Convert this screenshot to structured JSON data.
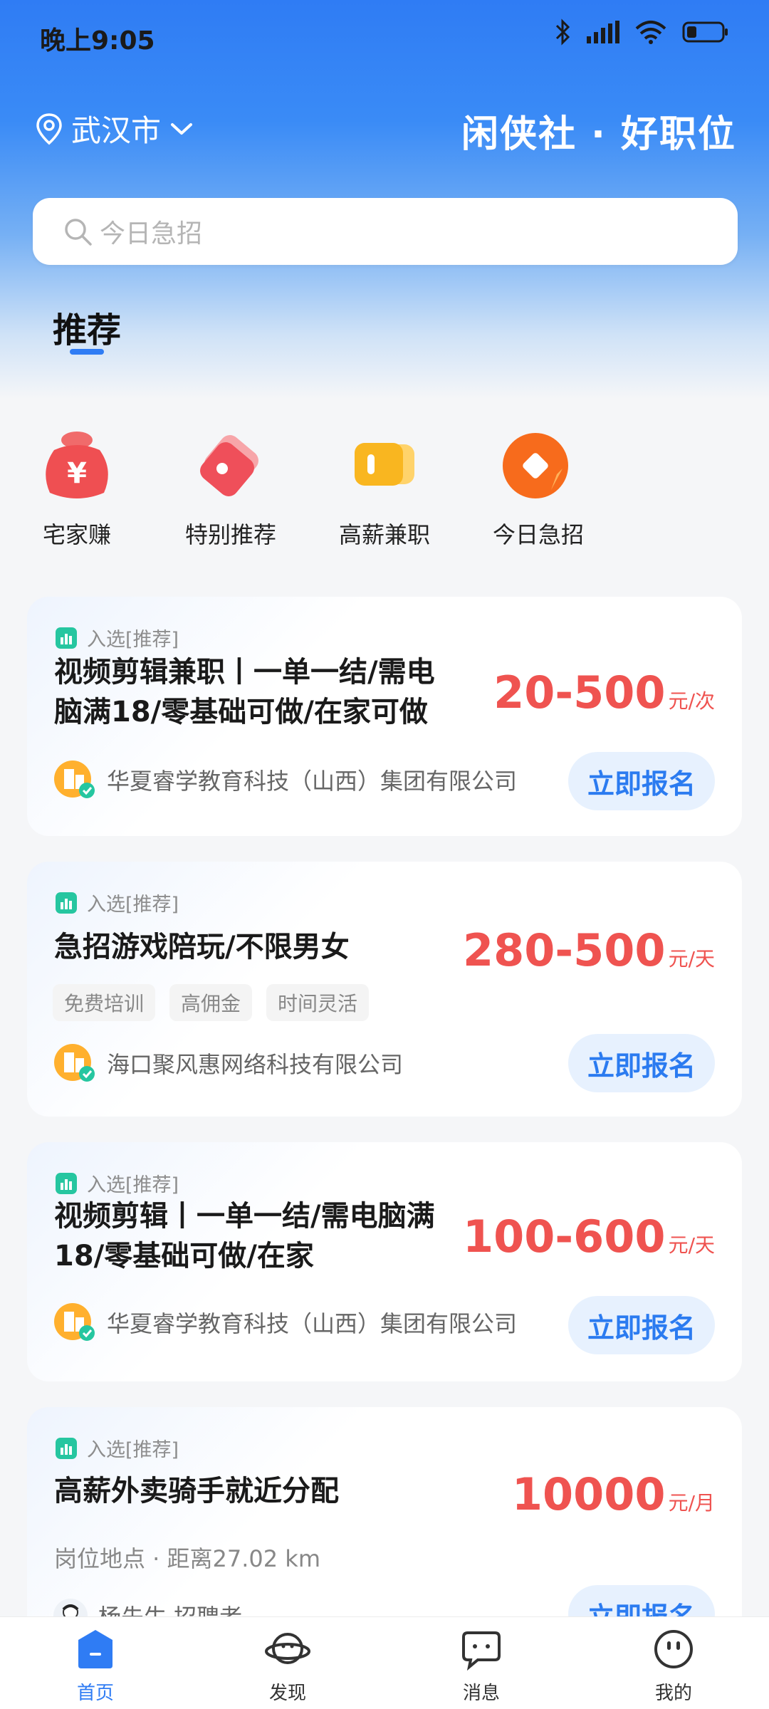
{
  "status_bar": {
    "time": "晚上9:05"
  },
  "header": {
    "city": "武汉市",
    "brand": "闲侠社 · 好职位"
  },
  "search": {
    "placeholder": "今日急招"
  },
  "tabs": {
    "active": "推荐"
  },
  "categories": [
    {
      "label": "宅家赚",
      "icon": "money-bag-icon"
    },
    {
      "label": "特别推荐",
      "icon": "tag-icon"
    },
    {
      "label": "高薪兼职",
      "icon": "wallet-icon"
    },
    {
      "label": "今日急招",
      "icon": "lightning-icon"
    }
  ],
  "jobs": [
    {
      "badge": "入选[推荐]",
      "title_line1": "视频剪辑兼职丨一单一结/需电",
      "title_line2": "脑满18/零基础可做/在家可做",
      "salary": "20-500",
      "unit": "元/次",
      "company": "华夏睿学教育科技（山西）集团有限公司",
      "apply": "立即报名"
    },
    {
      "badge": "入选[推荐]",
      "title_line1": "急招游戏陪玩/不限男女",
      "salary": "280-500",
      "unit": "元/天",
      "tags": [
        "免费培训",
        "高佣金",
        "时间灵活"
      ],
      "company": "海口聚风惠网络科技有限公司",
      "apply": "立即报名"
    },
    {
      "badge": "入选[推荐]",
      "title_line1": "视频剪辑丨一单一结/需电脑满",
      "title_line2": "18/零基础可做/在家",
      "salary": "100-600",
      "unit": "元/天",
      "company": "华夏睿学教育科技（山西）集团有限公司",
      "apply": "立即报名"
    },
    {
      "badge": "入选[推荐]",
      "title_line1": "高薪外卖骑手就近分配",
      "salary": "10000",
      "unit": "元/月",
      "location_line": "岗位地点 · 距离27.02 km",
      "recruiter": "杨先生 招聘者",
      "apply": "立即报名"
    }
  ],
  "bottom_nav": [
    {
      "label": "首页",
      "icon": "home-icon",
      "active": true
    },
    {
      "label": "发现",
      "icon": "planet-icon"
    },
    {
      "label": "消息",
      "icon": "chat-icon"
    },
    {
      "label": "我的",
      "icon": "profile-icon"
    }
  ],
  "colors": {
    "primary": "#2f7cf4",
    "salary": "#ef5350",
    "apply_bg": "#e7f1fe"
  }
}
